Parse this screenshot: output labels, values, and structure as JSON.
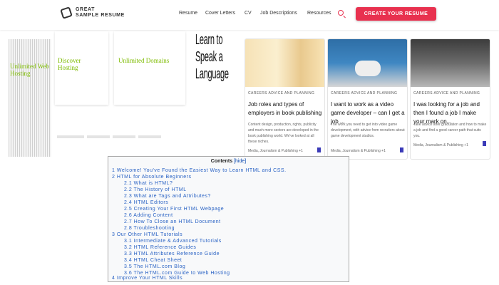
{
  "header": {
    "logo_line1": "GREAT",
    "logo_line2": "SAMPLE RESUME",
    "nav": [
      "Resume",
      "Cover Letters",
      "CV",
      "Job Descriptions",
      "Resources"
    ],
    "cta": "CREATE YOUR RESUME",
    "search_icon": "search-icon"
  },
  "ads": {
    "green_text_1": "Unlimited Web Hosting",
    "green_text_2": "Discover Hosting",
    "green_text_3": "Unlimited Domains",
    "learn_text": "Learn to Speak a Language"
  },
  "cards": [
    {
      "category": "CAREERS ADVICE AND PLANNING",
      "title": "Job roles and types of employers in book publishing",
      "desc": "Content design, production, rights, publicity and much more sectors are developed in the book publishing world. We've looked at all these niches.",
      "meta": "Media, Journalism & Publishing +1"
    },
    {
      "category": "CAREERS ADVICE AND PLANNING",
      "title": "I want to work as a video game developer – can I get a job ...",
      "desc": "The work you need to get into video game development, with advice from recruiters about game development studios.",
      "meta": "Media, Journalism & Publishing +1"
    },
    {
      "category": "CAREERS ADVICE AND PLANNING",
      "title": "I was looking for a job and then I found a job I make your mark on...",
      "desc": "Take advice after graduation and how to make a job and find a good career path that suits you.",
      "meta": "Media, Journalism & Publishing +1"
    }
  ],
  "toc": {
    "title": "Contents",
    "hide": "[hide]",
    "items": [
      "1 Welcome! You've Found the Easiest Way to Learn HTML and CSS.",
      "2 HTML for Absolute Beginners",
      "2.1 What is HTML?",
      "2.2 The History of HTML",
      "2.3 What are Tags and Attributes?",
      "2.4 HTML Editors",
      "2.5 Creating Your First HTML Webpage",
      "2.6 Adding Content",
      "2.7 How To Close an HTML Document",
      "2.8 Troubleshooting",
      "3 Our Other HTML Tutorials",
      "3.1 Intermediate & Advanced Tutorials",
      "3.2 HTML Reference Guides",
      "3.3 HTML Attributes Reference Guide",
      "3.4 HTML Cheat Sheet",
      "3.5 The HTML.com Blog",
      "3.6 The HTML.com Guide to Web Hosting",
      "4 Improve Your HTML Skills"
    ]
  },
  "colors": {
    "accent": "#e8314f",
    "link": "#2962c4",
    "ad_green": "#7dbb00"
  }
}
